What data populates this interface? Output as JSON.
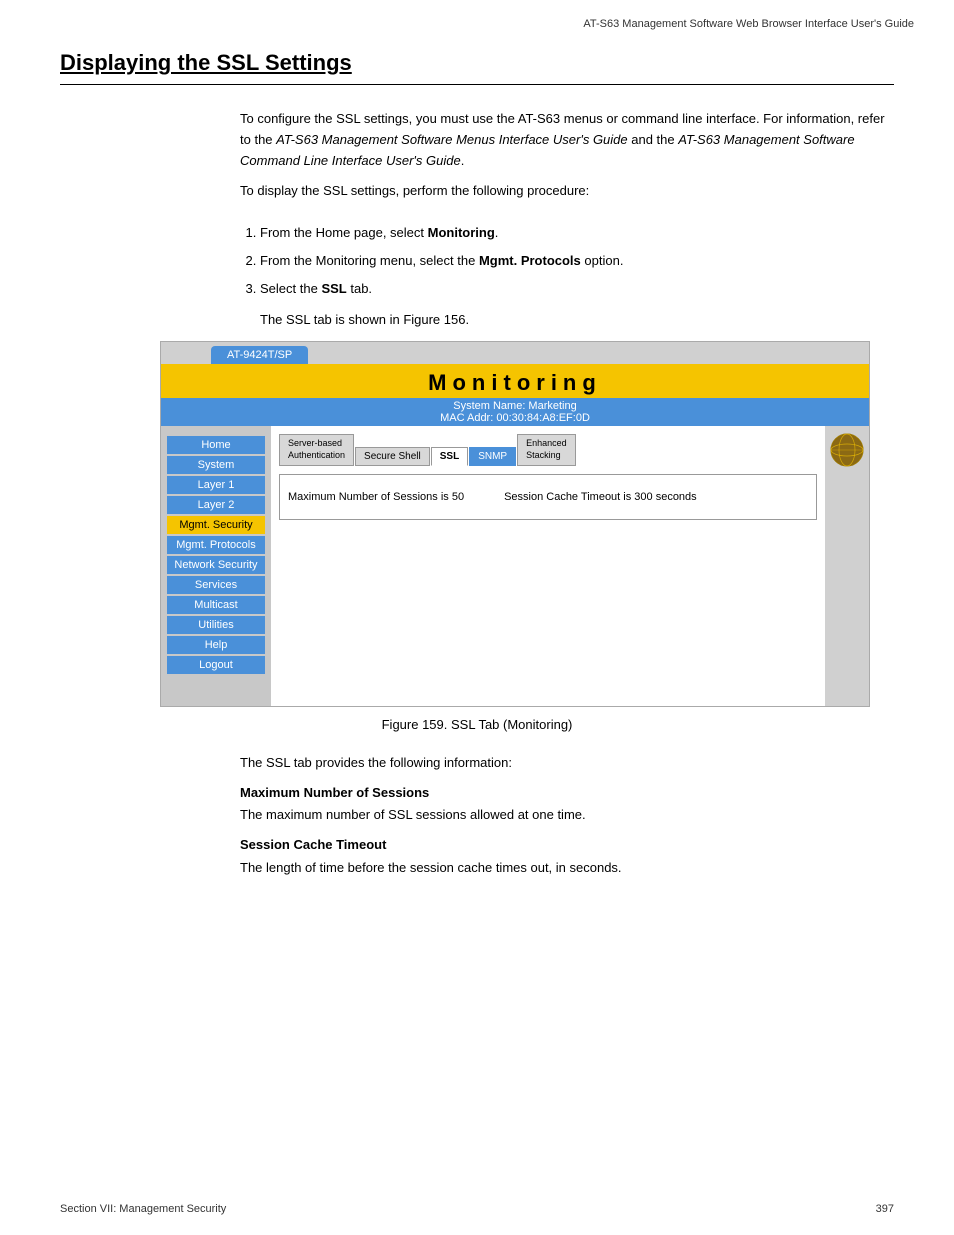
{
  "header": {
    "title": "AT-S63 Management Software Web Browser Interface User's Guide"
  },
  "page": {
    "title": "Displaying the SSL Settings",
    "intro_paragraph1": "To configure the SSL settings, you must use the AT-S63 menus or command line interface. For information, refer to the ",
    "intro_italic1": "AT-S63 Management Software Menus Interface User's Guide",
    "intro_and": " and the ",
    "intro_italic2": "AT-S63 Management Software Command Line Interface User's Guide",
    "intro_end": ".",
    "intro_paragraph2": "To display the SSL settings, perform the following procedure:",
    "steps": [
      {
        "num": 1,
        "text": "From the Home page, select ",
        "bold": "Monitoring",
        "rest": "."
      },
      {
        "num": 2,
        "text": "From the Monitoring menu, select the ",
        "bold": "Mgmt. Protocols",
        "rest": " option."
      },
      {
        "num": 3,
        "text": "Select the ",
        "bold": "SSL",
        "rest": " tab."
      }
    ],
    "step3_note": "The SSL tab is shown in Figure 156.",
    "figure_caption": "Figure 159. SSL Tab (Monitoring)",
    "description_intro": "The SSL tab provides the following information:",
    "descriptions": [
      {
        "label": "Maximum Number of Sessions",
        "text": "The maximum number of SSL sessions allowed at one time."
      },
      {
        "label": "Session Cache Timeout",
        "text": "The length of time before the session cache times out, in seconds."
      }
    ]
  },
  "screenshot": {
    "device_tab": "AT-9424T/SP",
    "monitoring_title": "Monitoring",
    "system_name": "System Name: Marketing",
    "mac_addr": "MAC Addr: 00:30:84:A8:EF:0D",
    "nav_items": [
      {
        "label": "Home",
        "style": "blue"
      },
      {
        "label": "System",
        "style": "blue"
      },
      {
        "label": "Layer 1",
        "style": "blue"
      },
      {
        "label": "Layer 2",
        "style": "blue"
      },
      {
        "label": "Mgmt. Security",
        "style": "yellow"
      },
      {
        "label": "Mgmt. Protocols",
        "style": "plain"
      },
      {
        "label": "Network Security",
        "style": "blue"
      },
      {
        "label": "Services",
        "style": "blue"
      },
      {
        "label": "Multicast",
        "style": "blue"
      },
      {
        "label": "Utilities",
        "style": "blue"
      },
      {
        "label": "Help",
        "style": "blue"
      },
      {
        "label": "Logout",
        "style": "blue"
      }
    ],
    "tabs": [
      {
        "label": "Server-based\nAuthentication",
        "active": false
      },
      {
        "label": "Secure Shell",
        "active": false
      },
      {
        "label": "SSL",
        "active": true
      },
      {
        "label": "SNMP",
        "active": false,
        "style": "blue"
      },
      {
        "label": "Enhanced\nStacking",
        "active": false
      }
    ],
    "ssl_max_sessions": "Maximum Number of Sessions is 50",
    "ssl_session_timeout": "Session Cache Timeout is 300 seconds"
  },
  "footer": {
    "left": "Section VII: Management Security",
    "right": "397"
  }
}
